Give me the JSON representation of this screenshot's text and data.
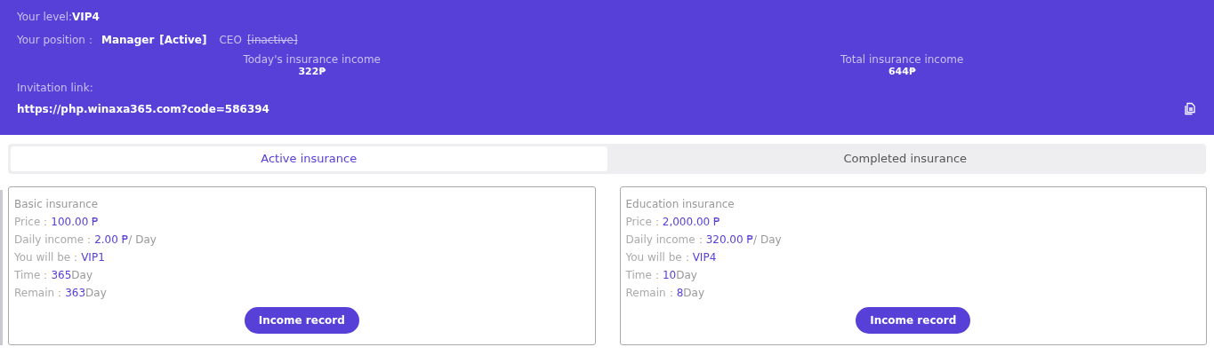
{
  "header": {
    "level_label": "Your level:",
    "level_value": "VIP4",
    "position_label": "Your position：",
    "positions": [
      {
        "name": "Manager",
        "status": "[Active]",
        "active": true
      },
      {
        "name": "CEO",
        "status": "[inactive]",
        "active": false
      }
    ],
    "stats": [
      {
        "label": "Today's insurance income",
        "value": "322₱"
      },
      {
        "label": "Total insurance income",
        "value": "644₱"
      }
    ],
    "invitation_label": "Invitation link:",
    "invitation_link": "https://php.winaxa365.com?code=586394"
  },
  "tabs": [
    {
      "label": "Active insurance",
      "selected": true
    },
    {
      "label": "Completed insurance",
      "selected": false
    }
  ],
  "cards": [
    {
      "title": "Basic insurance",
      "fields": [
        {
          "label": "Price：",
          "value": "100.00 ₱"
        },
        {
          "label": "Daily income：",
          "value": "2.00 ₱",
          "suffix": "/ Day"
        },
        {
          "label": "You will be：",
          "value": "VIP1"
        },
        {
          "label": "Time：",
          "value": "365",
          "suffix": "Day"
        },
        {
          "label": "Remain：",
          "value": "363",
          "suffix": "Day"
        }
      ],
      "button": "Income record"
    },
    {
      "title": "Education insurance",
      "fields": [
        {
          "label": "Price：",
          "value": "2,000.00 ₱"
        },
        {
          "label": "Daily income：",
          "value": "320.00 ₱",
          "suffix": "/ Day"
        },
        {
          "label": "You will be：",
          "value": "VIP4"
        },
        {
          "label": "Time：",
          "value": "10",
          "suffix": "Day"
        },
        {
          "label": "Remain：",
          "value": "8",
          "suffix": "Day"
        }
      ],
      "button": "Income record"
    }
  ]
}
